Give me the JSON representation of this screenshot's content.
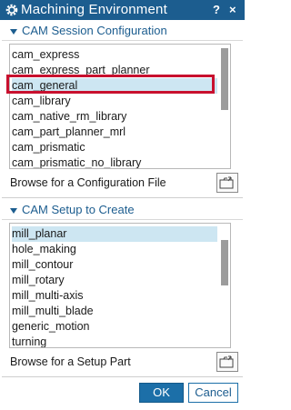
{
  "window": {
    "title": "Machining Environment",
    "help": "?",
    "close": "×"
  },
  "session_config": {
    "header": "CAM Session Configuration",
    "items": [
      "cam_express",
      "cam_express_part_planner",
      "cam_general",
      "cam_library",
      "cam_native_rm_library",
      "cam_part_planner_mrl",
      "cam_prismatic",
      "cam_prismatic_no_library"
    ],
    "selected": "cam_general",
    "browse_label": "Browse for a Configuration File"
  },
  "setup": {
    "header": "CAM Setup to Create",
    "items": [
      "mill_planar",
      "hole_making",
      "mill_contour",
      "mill_rotary",
      "mill_multi-axis",
      "mill_multi_blade",
      "generic_motion",
      "turning"
    ],
    "selected": "mill_planar",
    "browse_label": "Browse for a Setup Part"
  },
  "buttons": {
    "ok": "OK",
    "cancel": "Cancel"
  },
  "colors": {
    "titlebar": "#1c5d8f",
    "accent": "#1c5d8f",
    "selection": "#cde6f2",
    "highlight": "#c8102e"
  }
}
